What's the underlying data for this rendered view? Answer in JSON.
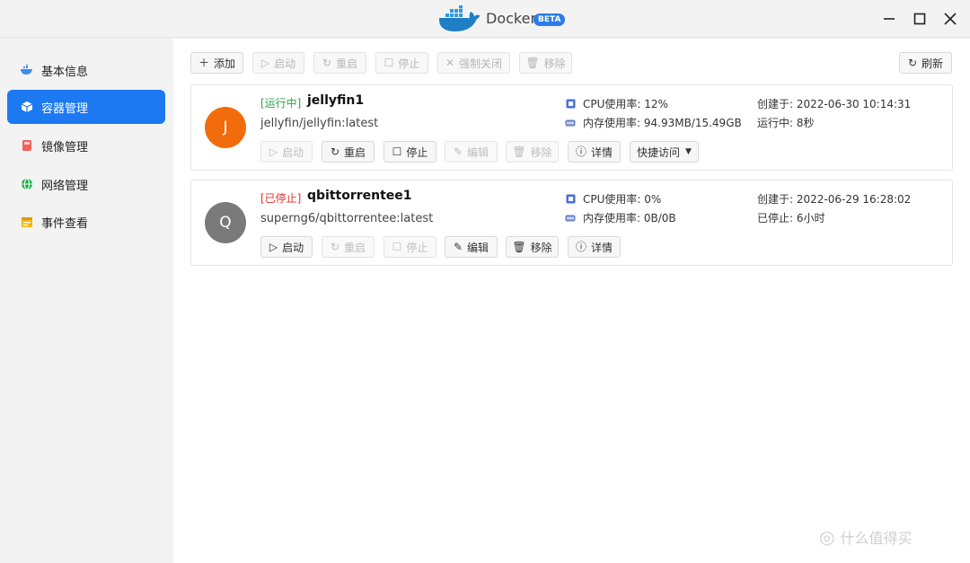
{
  "window": {
    "title": "Docker",
    "badge": "BETA"
  },
  "sidebar": {
    "items": [
      {
        "label": "基本信息",
        "icon": "docker-whale-icon",
        "active": false
      },
      {
        "label": "容器管理",
        "icon": "cube-icon",
        "active": true
      },
      {
        "label": "镜像管理",
        "icon": "image-icon",
        "active": false
      },
      {
        "label": "网络管理",
        "icon": "globe-icon",
        "active": false
      },
      {
        "label": "事件查看",
        "icon": "calendar-icon",
        "active": false
      }
    ]
  },
  "toolbar": {
    "add": "添加",
    "start": "启动",
    "restart": "重启",
    "stop": "停止",
    "force_close": "强制关闭",
    "remove": "移除",
    "refresh": "刷新"
  },
  "containers": [
    {
      "avatar": "J",
      "avatar_color": "#f26c0c",
      "status": "[运行中]",
      "name": "jellyfin1",
      "image": "jellyfin/jellyfin:latest",
      "cpu": "CPU使用率: 12%",
      "mem": "内存使用率: 94.93MB/15.49GB",
      "created": "创建于: 2022-06-30 10:14:31",
      "uptime": "运行中: 8秒",
      "actions": {
        "start": "启动",
        "restart": "重启",
        "stop": "停止",
        "edit": "编辑",
        "remove": "移除",
        "details": "详情",
        "quick": "快捷访问"
      }
    },
    {
      "avatar": "Q",
      "avatar_color": "#7a7a7a",
      "status": "[已停止]",
      "name": "qbittorrentee1",
      "image": "superng6/qbittorrentee:latest",
      "cpu": "CPU使用率: 0%",
      "mem": "内存使用率: 0B/0B",
      "created": "创建于: 2022-06-29 16:28:02",
      "uptime": "已停止: 6小时",
      "actions": {
        "start": "启动",
        "restart": "重启",
        "stop": "停止",
        "edit": "编辑",
        "remove": "移除",
        "details": "详情"
      }
    }
  ],
  "watermark": "什么值得买",
  "colors": {
    "accent": "#1d79f2",
    "running": "#2da44e",
    "stopped": "#e0312f"
  }
}
